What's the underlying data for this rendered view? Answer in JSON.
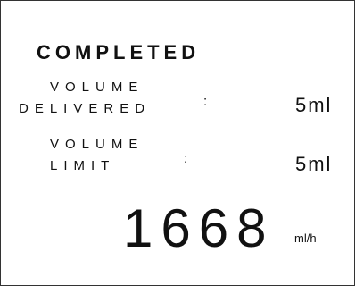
{
  "status": {
    "text": "COMPLETED"
  },
  "volume_delivered": {
    "label_line1": "VOLUME",
    "label_line2": "DELIVERED",
    "separator": ":",
    "value": "5ml"
  },
  "volume_limit": {
    "label_line1": "VOLUME",
    "label_line2": "LIMIT",
    "separator": ":",
    "value": "5ml"
  },
  "rate": {
    "value": "1668",
    "unit": "ml/h"
  }
}
